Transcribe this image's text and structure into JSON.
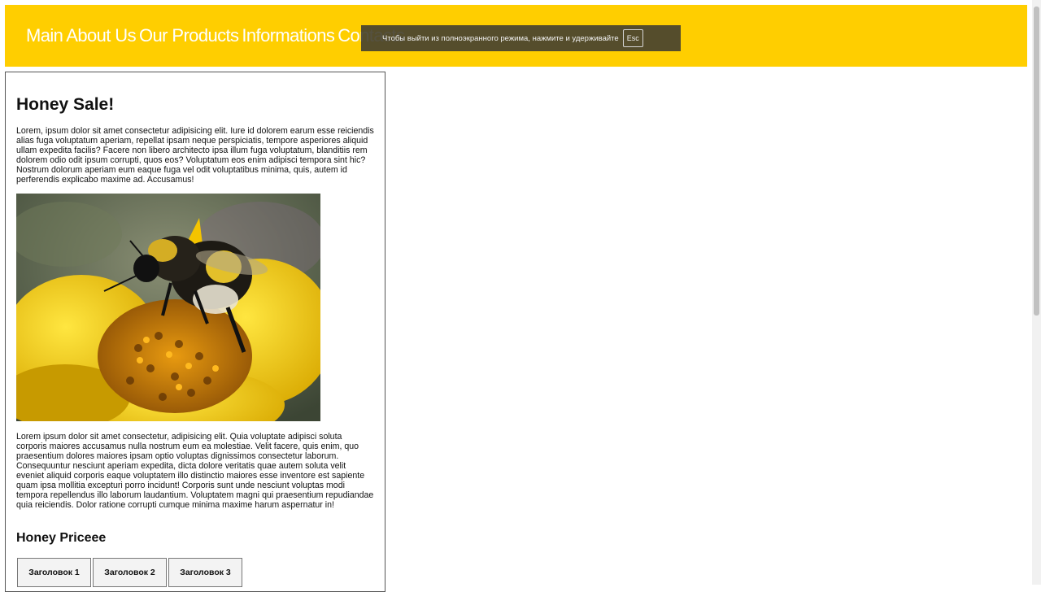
{
  "nav": {
    "items": [
      {
        "label": "Main"
      },
      {
        "label": "About Us"
      },
      {
        "label": "Our Products"
      },
      {
        "label": "Informations"
      },
      {
        "label": "Contacts"
      }
    ]
  },
  "fullscreen_notice": {
    "text": "Чтобы выйти из полноэкранного режима, нажмите и удерживайте",
    "key": "Esc"
  },
  "article": {
    "title": "Honey Sale!",
    "paragraph_1": "Lorem, ipsum dolor sit amet consectetur adipisicing elit. Iure id dolorem earum esse reiciendis alias fuga voluptatum aperiam, repellat ipsam neque perspiciatis, tempore asperiores aliquid ullam expedita facilis? Facere non libero architecto ipsa illum fuga voluptatum, blanditiis rem dolorem odio odit ipsum corrupti, quos eos? Voluptatum eos enim adipisci tempora sint hic? Nostrum dolorum aperiam eum eaque fuga vel odit voluptatibus minima, quis, autem id perferendis explicabo maxime ad. Accusamus!",
    "paragraph_2": "Lorem ipsum dolor sit amet consectetur, adipisicing elit. Quia voluptate adipisci soluta corporis maiores accusamus nulla nostrum eum ea molestiae. Velit facere, quis enim, quo praesentium dolores maiores ipsam optio voluptas dignissimos consectetur laborum. Consequuntur nesciunt aperiam expedita, dicta dolore veritatis quae autem soluta velit eveniet aliquid corporis eaque voluptatem illo distinctio maiores esse inventore est sapiente quam ipsa mollitia excepturi porro incidunt! Corporis sunt unde nesciunt voluptas modi tempora repellendus illo laborum laudantium. Voluptatem magni qui praesentium repudiandae quia reiciendis. Dolor ratione corrupti cumque minima maxime harum aspernatur in!",
    "section_title": "Honey Priceee",
    "tabs": [
      {
        "label": "Заголовок 1"
      },
      {
        "label": "Заголовок 2"
      },
      {
        "label": "Заголовок 3"
      }
    ]
  },
  "colors": {
    "navbar": "#ffce00",
    "nav_text": "#ffffff"
  }
}
